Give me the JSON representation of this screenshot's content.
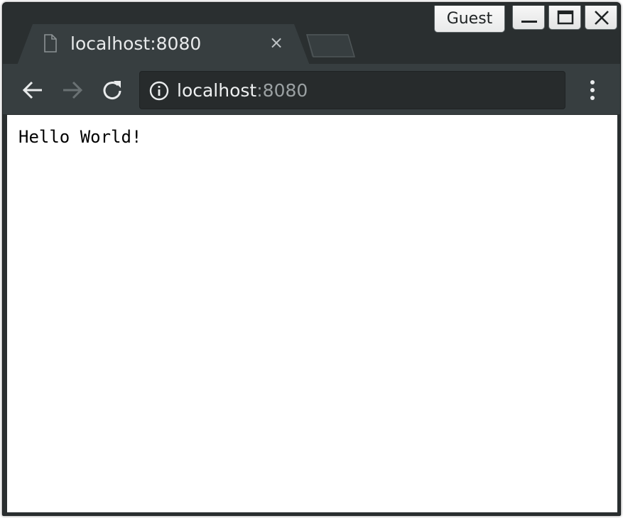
{
  "browser": {
    "tab": {
      "title": "localhost:8080",
      "page_icon": "document-icon",
      "close_glyph": "×"
    },
    "profile": {
      "label": "Guest"
    },
    "window_controls": [
      "minimize-icon",
      "maximize-icon",
      "close-icon"
    ],
    "toolbar": {
      "back_icon": "arrow-left-icon",
      "forward_icon": "arrow-right-icon",
      "reload_icon": "reload-icon",
      "menu_icon": "kebab-menu-icon"
    },
    "omnibox": {
      "security_icon": "info-icon",
      "url_host": "localhost",
      "url_port": ":8080"
    }
  },
  "page": {
    "body_text": "Hello World!"
  },
  "colors": {
    "frame": "#2a2f30",
    "toolbar": "#373e40",
    "omnibox": "#272b2c",
    "url_text": "#eef0f1",
    "url_port_text": "#9aa0a2",
    "page_background": "#ffffff"
  }
}
